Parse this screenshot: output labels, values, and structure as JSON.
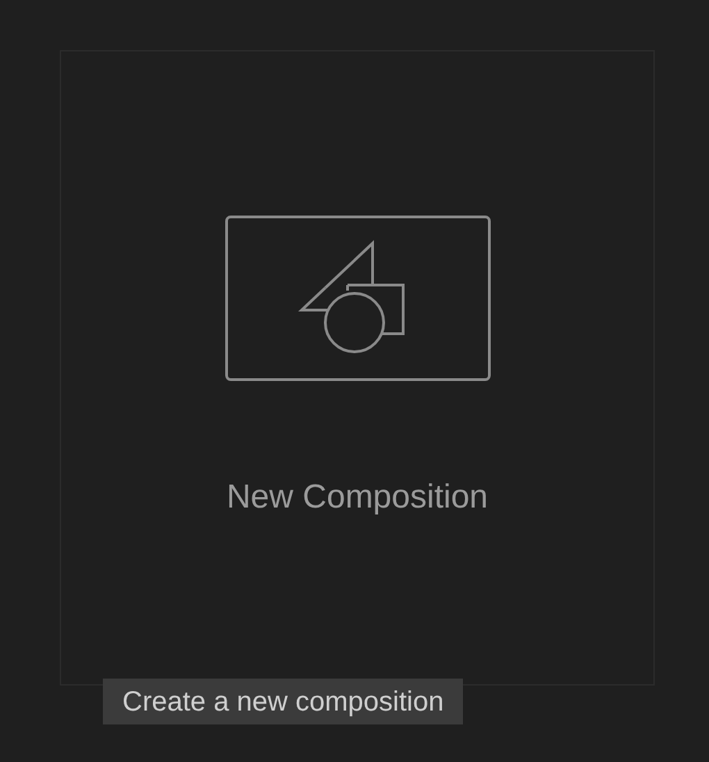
{
  "card": {
    "title": "New Composition"
  },
  "tooltip": {
    "text": "Create a new composition"
  }
}
